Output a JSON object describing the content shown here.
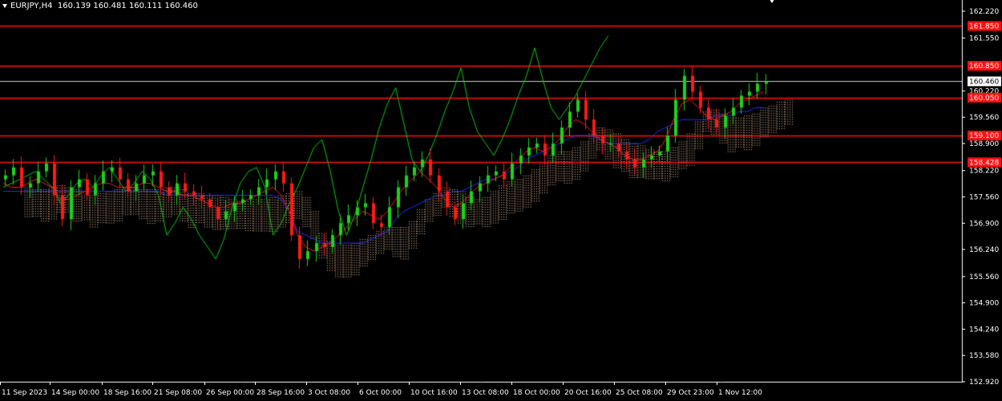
{
  "symbol": {
    "pair": "EURJPY,H4",
    "quote": "160.139 160.481 160.111 160.460"
  },
  "chart_data": {
    "type": "candlestick",
    "symbol": "EURJPY,H4",
    "ohlc_last": [
      160.139,
      160.481,
      160.111,
      160.46
    ],
    "current_price": 160.46,
    "ylim": [
      152.92,
      162.22
    ],
    "y_ticks": [
      "162.220",
      "161.550",
      "160.220",
      "159.560",
      "158.900",
      "158.220",
      "157.560",
      "156.900",
      "156.240",
      "155.560",
      "154.900",
      "154.240",
      "153.580",
      "152.920"
    ],
    "x_ticks": [
      "11 Sep 2023",
      "14 Sep 00:00",
      "18 Sep 16:00",
      "21 Sep 08:00",
      "26 Sep 00:00",
      "28 Sep 16:00",
      "3 Oct 08:00",
      "6 Oct 00:00",
      "10 Oct 16:00",
      "13 Oct 08:00",
      "18 Oct 00:00",
      "20 Oct 16:00",
      "25 Oct 08:00",
      "29 Oct 23:00",
      "1 Nov 12:00"
    ],
    "levels": [
      {
        "label": "161.850",
        "value": 161.85
      },
      {
        "label": "160.850",
        "value": 160.85
      },
      {
        "label": "160.050",
        "value": 160.05
      },
      {
        "label": "159.100",
        "value": 159.1
      },
      {
        "label": "158.428",
        "value": 158.428
      }
    ],
    "price": [
      158.1,
      158.3,
      157.8,
      157.9,
      158.2,
      158.4,
      157.6,
      157.0,
      157.8,
      158.0,
      157.6,
      157.9,
      158.2,
      158.3,
      158.0,
      157.7,
      157.9,
      158.1,
      158.2,
      157.8,
      157.6,
      157.9,
      157.7,
      157.6,
      157.5,
      157.3,
      157.0,
      157.2,
      157.4,
      157.5,
      157.6,
      157.8,
      158.0,
      158.2,
      157.9,
      156.6,
      156.0,
      156.2,
      156.4,
      156.3,
      156.6,
      156.9,
      157.1,
      157.3,
      157.4,
      156.9,
      156.8,
      157.3,
      157.8,
      158.1,
      158.3,
      158.5,
      158.1,
      157.7,
      157.3,
      157.0,
      157.4,
      157.7,
      157.9,
      158.1,
      158.2,
      158.0,
      158.4,
      158.6,
      158.8,
      158.9,
      158.6,
      158.9,
      159.3,
      159.7,
      160.0,
      159.5,
      159.1,
      158.9,
      158.9,
      158.7,
      158.5,
      158.3,
      158.5,
      158.6,
      158.7,
      159.1,
      160.0,
      160.6,
      160.2,
      159.8,
      159.5,
      159.3,
      159.6,
      159.8,
      160.1,
      160.2,
      160.4,
      160.46
    ],
    "tenkan": [
      157.9,
      157.8,
      157.8,
      157.9,
      158.0,
      157.9,
      157.8,
      157.5,
      157.5,
      157.6,
      157.7,
      157.8,
      157.9,
      157.9,
      157.8,
      157.8,
      157.8,
      157.9,
      157.9,
      157.8,
      157.7,
      157.7,
      157.6,
      157.6,
      157.5,
      157.4,
      157.3,
      157.3,
      157.4,
      157.4,
      157.5,
      157.6,
      157.7,
      157.8,
      157.6,
      157.2,
      156.6,
      156.3,
      156.2,
      156.3,
      156.4,
      156.6,
      156.8,
      157.0,
      157.2,
      157.1,
      157.0,
      157.2,
      157.5,
      157.8,
      158.0,
      158.2,
      158.0,
      157.8,
      157.5,
      157.3,
      157.4,
      157.6,
      157.8,
      157.9,
      158.0,
      158.1,
      158.3,
      158.5,
      158.7,
      158.8,
      158.7,
      158.8,
      159.0,
      159.3,
      159.5,
      159.4,
      159.2,
      159.0,
      158.9,
      158.8,
      158.6,
      158.5,
      158.5,
      158.6,
      158.7,
      159.0,
      159.5,
      159.9,
      160.0,
      159.8,
      159.6,
      159.5,
      159.6,
      159.7,
      159.9,
      160.0,
      160.1,
      160.2
    ],
    "kijun": [
      157.7,
      157.7,
      157.7,
      157.7,
      157.7,
      157.7,
      157.7,
      157.7,
      157.7,
      157.7,
      157.7,
      157.7,
      157.7,
      157.7,
      157.7,
      157.7,
      157.7,
      157.7,
      157.7,
      157.7,
      157.6,
      157.6,
      157.6,
      157.6,
      157.6,
      157.6,
      157.6,
      157.6,
      157.6,
      157.6,
      157.6,
      157.6,
      157.6,
      157.6,
      157.5,
      157.2,
      156.7,
      156.6,
      156.5,
      156.4,
      156.4,
      156.4,
      156.4,
      156.4,
      156.4,
      156.5,
      156.6,
      156.7,
      157.0,
      157.2,
      157.3,
      157.4,
      157.5,
      157.6,
      157.6,
      157.7,
      157.7,
      157.8,
      157.9,
      158.0,
      158.0,
      158.1,
      158.2,
      158.3,
      158.5,
      158.6,
      158.7,
      158.8,
      158.9,
      159.0,
      159.1,
      159.1,
      159.1,
      159.0,
      158.9,
      158.9,
      158.9,
      158.9,
      158.9,
      159.0,
      159.2,
      159.3,
      159.4,
      159.5,
      159.5,
      159.5,
      159.5,
      159.6,
      159.6,
      159.6,
      159.7,
      159.7,
      159.8,
      159.8
    ],
    "chikou": [
      157.8,
      157.9,
      158.0,
      158.1,
      158.2,
      158.0,
      157.8,
      157.4,
      157.6,
      157.9,
      158.0,
      157.8,
      158.1,
      158.3,
      158.0,
      157.7,
      157.9,
      158.2,
      158.0,
      157.6,
      156.6,
      156.9,
      157.3,
      157.0,
      156.6,
      156.3,
      156.0,
      156.5,
      157.3,
      157.9,
      158.2,
      158.3,
      157.8,
      156.6,
      156.9,
      157.4,
      157.8,
      158.3,
      158.8,
      159.0,
      158.2,
      157.2,
      156.6,
      157.1,
      157.8,
      158.5,
      159.3,
      159.9,
      160.3,
      159.4,
      158.5,
      158.2,
      158.6,
      159.1,
      159.7,
      160.2,
      160.8,
      159.8,
      159.2,
      158.9,
      158.6,
      159.0,
      159.5,
      160.1,
      160.6,
      161.3,
      160.5,
      159.8,
      159.5,
      159.8,
      160.1,
      160.5,
      160.9,
      161.3,
      161.6
    ]
  }
}
